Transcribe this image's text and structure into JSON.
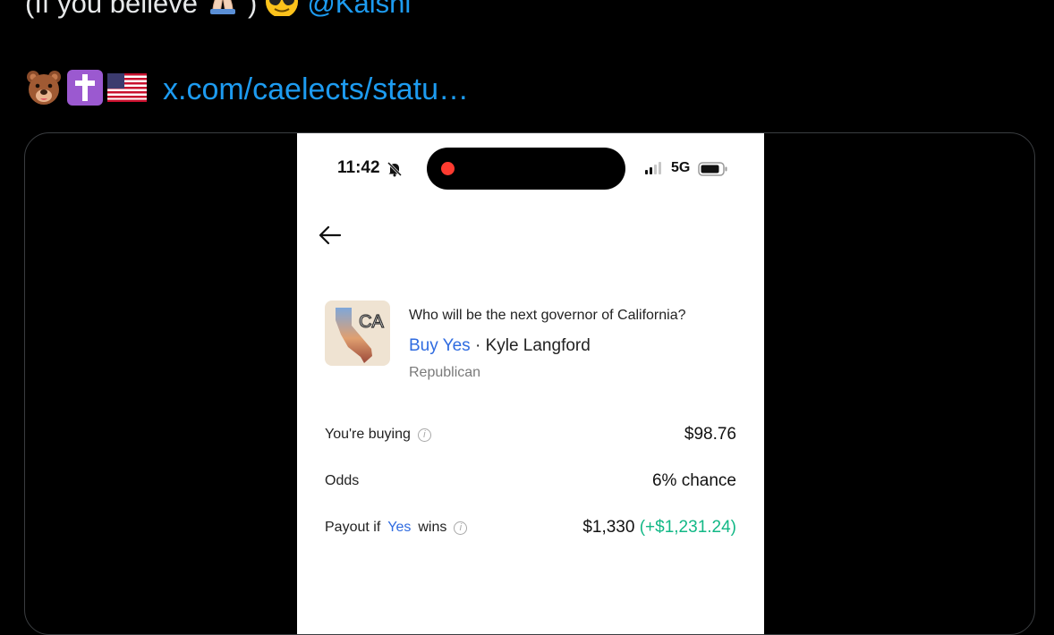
{
  "tweet": {
    "line1_text": "(If you believe",
    "line1_paren_close": ")",
    "mention": "@Kalshi",
    "link_text": "x.com/caelects/statu…",
    "emojis": [
      "bear-face",
      "latin-cross",
      "us-flag"
    ]
  },
  "phone": {
    "status": {
      "time": "11:42",
      "network": "5G"
    },
    "market": {
      "question": "Who will be the next governor of California?",
      "action": "Buy Yes",
      "separator": " · ",
      "candidate": "Kyle Langford",
      "party": "Republican",
      "thumb_label": "CA"
    },
    "rows": {
      "buying_label": "You're buying",
      "buying_value": "$98.76",
      "odds_label": "Odds",
      "odds_value": "6% chance",
      "payout_label_pre": "Payout if",
      "payout_label_yes": "Yes",
      "payout_label_post": "wins",
      "payout_value": "$1,330",
      "payout_gain": "(+$1,231.24)"
    }
  },
  "colors": {
    "link": "#1d9bf0",
    "accent_blue": "#2f6be0",
    "gain_green": "#12b886",
    "record_red": "#ff3b30"
  }
}
